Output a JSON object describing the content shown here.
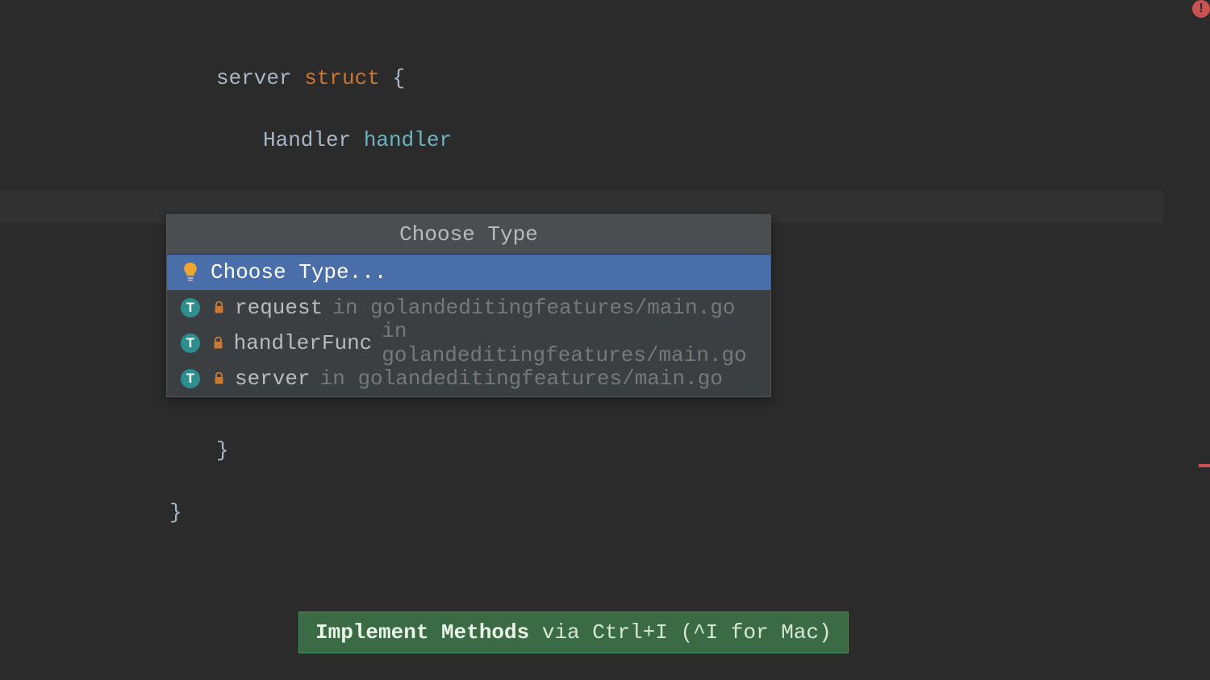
{
  "code": {
    "line1_pre": "server ",
    "line1_kw": "struct",
    "line1_post": " {",
    "line2_pre": "Handler ",
    "line2_type": "handler",
    "line3": "}",
    "line4": ")",
    "line_below_1": "}",
    "line_below_2": "}"
  },
  "popup": {
    "title": "Choose Type",
    "items": [
      {
        "label": "Choose Type...",
        "selected": true,
        "icon": "bulb"
      },
      {
        "label": "request",
        "loc": "golandeditingfeatures/main.go",
        "icon": "type"
      },
      {
        "label": "handlerFunc",
        "loc": "golandeditingfeatures/main.go",
        "icon": "type"
      },
      {
        "label": "server",
        "loc": "golandeditingfeatures/main.go",
        "icon": "type"
      }
    ]
  },
  "type_badge": "T",
  "in_word": "in",
  "banner": {
    "strong": "Implement Methods",
    "rest": " via Ctrl+I (^I for Mac)"
  },
  "error_glyph": "!"
}
